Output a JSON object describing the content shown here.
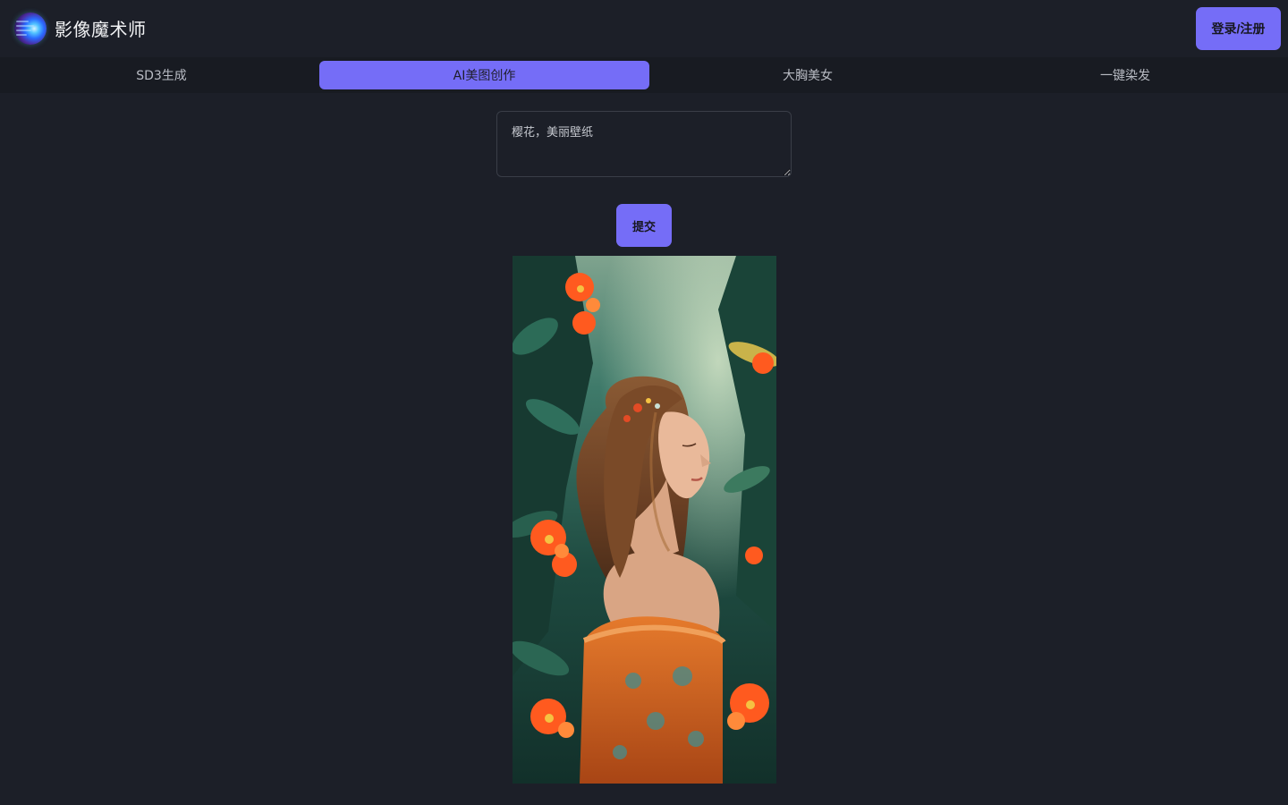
{
  "header": {
    "brand": "影像魔术师",
    "login_label": "登录/注册"
  },
  "tabs": [
    {
      "label": "SD3生成",
      "active": false
    },
    {
      "label": "AI美图创作",
      "active": true
    },
    {
      "label": "大胸美女",
      "active": false
    },
    {
      "label": "一键染发",
      "active": false
    }
  ],
  "form": {
    "prompt_value": "樱花，美丽壁纸",
    "submit_label": "提交"
  },
  "colors": {
    "accent": "#756df7",
    "background": "#1c1f28",
    "tabbar": "#181b22"
  },
  "icons": {
    "logo": "magic-orb-icon"
  }
}
